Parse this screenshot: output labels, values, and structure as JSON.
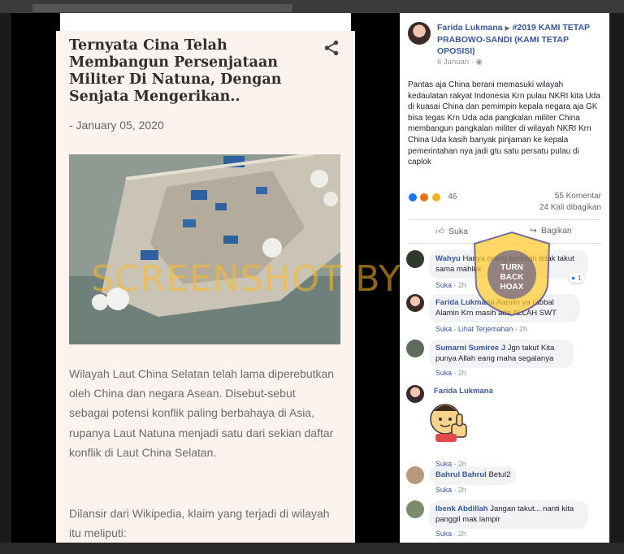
{
  "article": {
    "title": "Ternyata Cina Telah Membangun Persenjataan Militer Di Natuna, Dengan Senjata Mengerikan..",
    "date": "- January 05, 2020",
    "paragraph1": "Wilayah Laut China Selatan telah lama diperebutkan oleh China dan negara Asean. Disebut-sebut sebagai potensi konflik paling berbahaya di Asia, rupanya Laut Natuna menjadi satu dari sekian daftar konflik di Laut China Selatan.",
    "paragraph2": "Dilansir dari Wikipedia, klaim yang terjadi di wilayah itu meliputi:",
    "share_icon": "share-icon"
  },
  "post": {
    "author": "Farida Lukmana",
    "group": "#2019 KAMI TETAP PRABOWO-SANDI (KAMI TETAP OPOSISI)",
    "date": "6 Januari",
    "text": "Pantas aja China berani memasuki wilayah kedaulatan rakyat Indonesia Krn pulau NKRI kita Uda di kuasai China dan pemimpin kepala negara aja GK bisa tegas Krn Uda ada pangkalan militer China membangun pangkalan militer di wilayah NKRI Krn China Uda kasih banyak pinjaman ke kepala pemerintahan nya jadi gtu satu persatu pulau di caplok",
    "reaction_count": "46",
    "comments_count": "55 Komentar",
    "shares_count": "24 Kali dibagikan",
    "like_label": "Suka",
    "share_label": "Bagikan"
  },
  "comments": [
    {
      "name": "Wahyu",
      "text": "Hanya orang beriman tidak takut sama mahluk",
      "like": "Suka",
      "time": "2h",
      "badge": "1"
    },
    {
      "name": "Farida Lukmana",
      "text": "Aamiin ya rabbal Alamin Krn masih ada ALLAH SWT",
      "like": "Suka",
      "translate": "Lihat Terjemahan",
      "time": "2h"
    },
    {
      "name": "Sumarni Sumiree J",
      "text": "Jgn takut Kita punya Allah eang maha segalanya",
      "like": "Suka",
      "time": "2h"
    },
    {
      "name": "Farida Lukmana",
      "text": "",
      "like": "Suka",
      "time": "2h"
    },
    {
      "name": "Bahrul Bahrul",
      "text": "Betul2",
      "like": "Suka",
      "time": "2h"
    },
    {
      "name": "Ibenk Abdillah",
      "text": "Jangan takut... nanti kita panggil mak lampir",
      "like": "Suka",
      "time": "2h"
    }
  ],
  "watermark": {
    "text": "SCREENSHOT BY",
    "seal_top": "TURN BACK HOAX",
    "seal_ring": "MASYARAKAT ANTI FITNAH INDONESIA"
  },
  "colors": {
    "fb_blue": "#385898",
    "watermark": "#ffba28",
    "article_bg": "#fcf2ee"
  }
}
